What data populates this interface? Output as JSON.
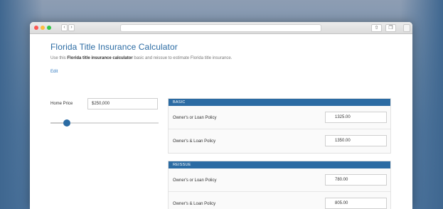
{
  "page": {
    "title": "Florida Title Insurance Calculator",
    "intro_prefix": "Use this ",
    "intro_bold": "Florida title insurance calculator",
    "intro_suffix": " basic and reissue to estimate Florida title insurance.",
    "edit_label": "Edit"
  },
  "home_price": {
    "label": "Home Price",
    "value": "$250,000",
    "slider_fraction": 0.15
  },
  "basic": {
    "heading": "BASIC",
    "rows": [
      {
        "label": "Owner's or Loan Policy",
        "value": "1325.00"
      },
      {
        "label": "Owner's & Loan Policy",
        "value": "1350.00"
      }
    ]
  },
  "reissue": {
    "heading": "REISSUE",
    "rows": [
      {
        "label": "Owner's or Loan Policy",
        "value": "780.00"
      },
      {
        "label": "Owner's & Loan Policy",
        "value": "805.00"
      }
    ]
  },
  "browser": {
    "back_icon": "chevron-left-icon",
    "forward_icon": "chevron-right-icon",
    "share_icon": "share-icon",
    "tabs_icon": "tabs-icon"
  },
  "colors": {
    "accent": "#2b6ba3",
    "link": "#2f78c0"
  }
}
